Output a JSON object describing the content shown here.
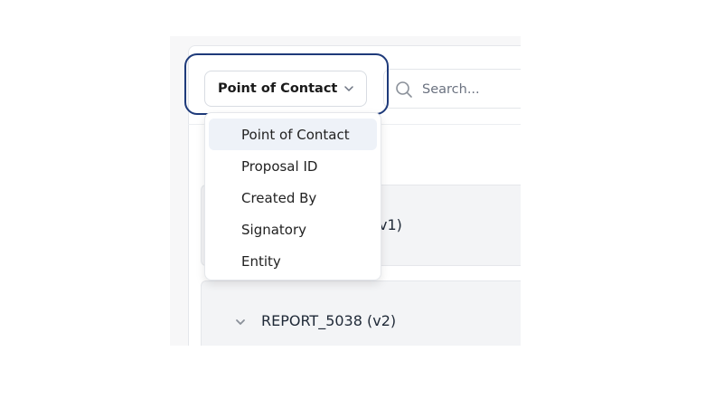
{
  "filter": {
    "selected_label": "Point of Contact",
    "options": [
      "Point of Contact",
      "Proposal ID",
      "Created By",
      "Signatory",
      "Entity"
    ]
  },
  "search": {
    "placeholder": "Search..."
  },
  "reports": [
    {
      "label": "v1)"
    },
    {
      "label": "REPORT_5038 (v2)"
    }
  ],
  "colors": {
    "highlight": "#1e3a7a",
    "selected_bg": "#eef2f8"
  }
}
